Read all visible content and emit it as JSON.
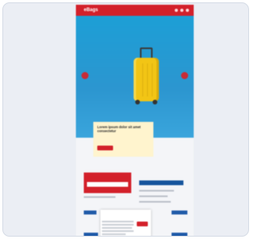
{
  "header": {
    "logo_text": "eBags",
    "brand_color": "#d3202a"
  },
  "hero": {
    "image_name": "yellow-suitcase",
    "background_color": "#1d9fd6",
    "prev_icon": "chevron-left-icon",
    "next_icon": "chevron-right-icon"
  },
  "promo": {
    "title": "Lorem ipsum dolor sit amet consectetur",
    "button_label": "",
    "background_color": "#fff4ce"
  },
  "lower": {
    "section_title": "",
    "subscribe_label": "",
    "accent_blue": "#15549c"
  },
  "cookie_banner": {
    "title": "",
    "heading": "",
    "accept_label": ""
  }
}
